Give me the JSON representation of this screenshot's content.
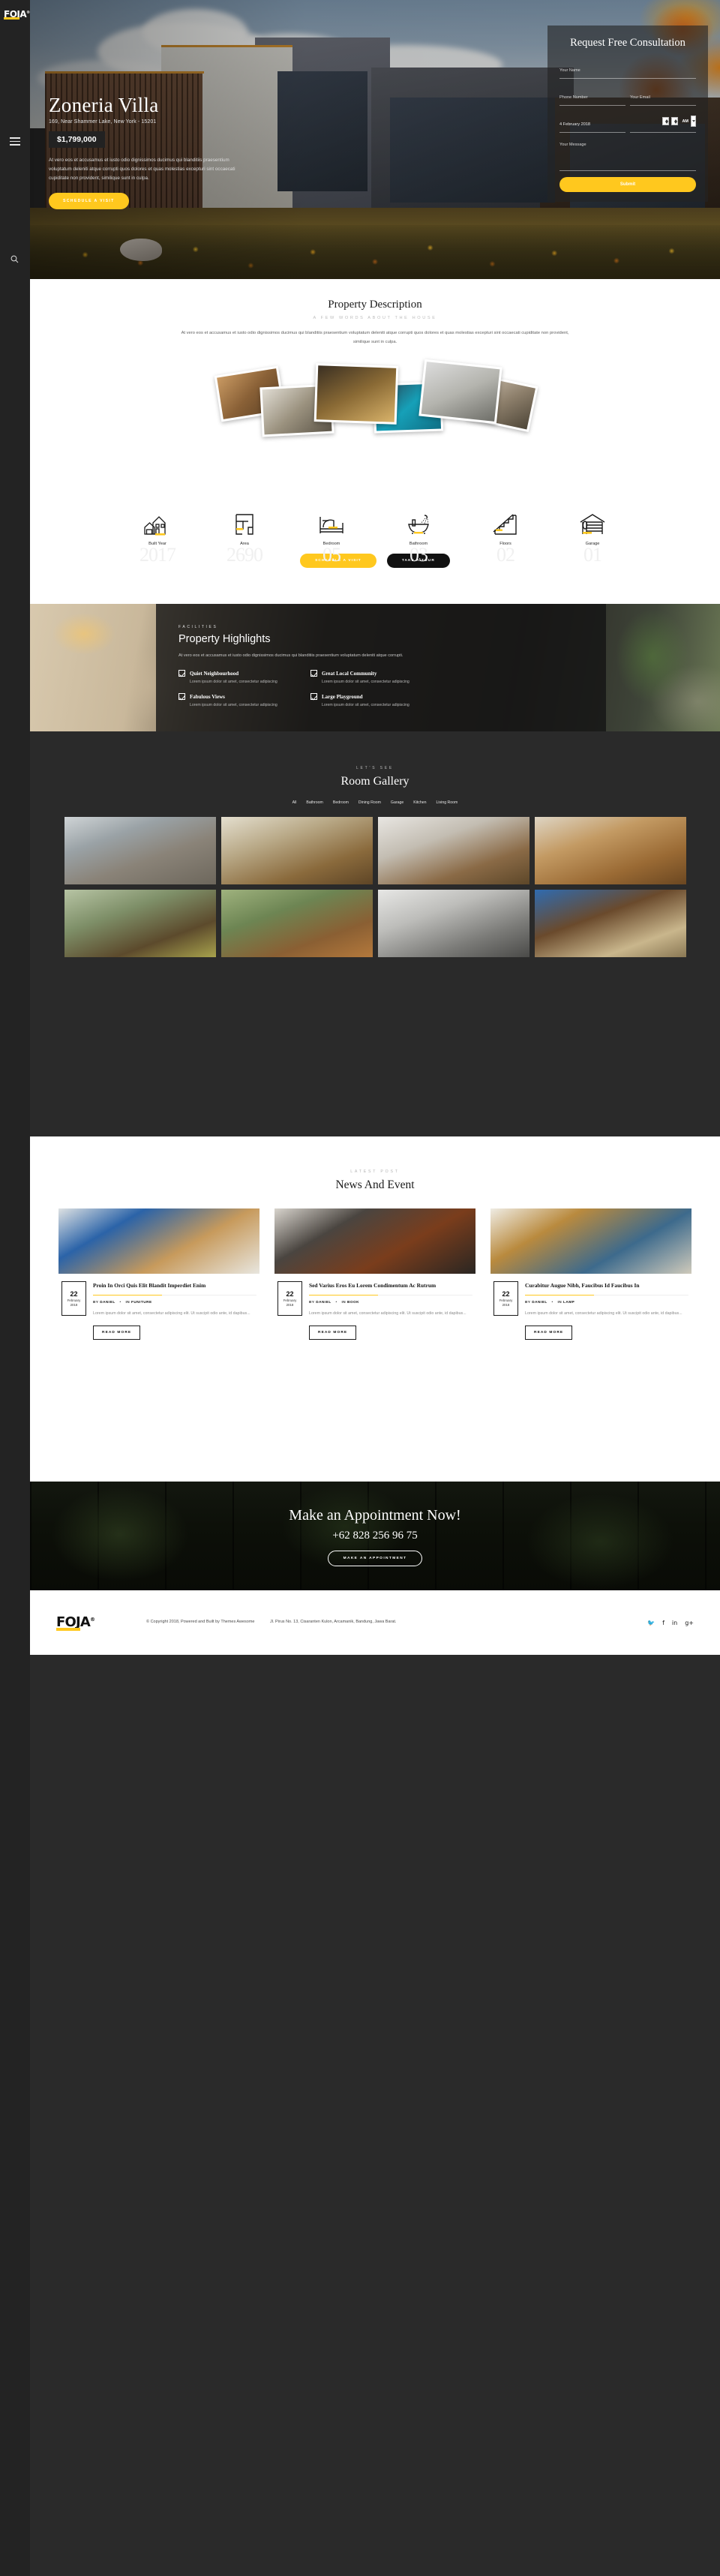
{
  "brand": {
    "name": "FOJA",
    "registered": "®",
    "accent": "#ffc81e"
  },
  "sidebar": {
    "menu_icon": "hamburger-icon",
    "search_icon": "search-icon"
  },
  "hero": {
    "title": "Zoneria Villa",
    "address": "169, Near Shammer Lake, New York - 15201",
    "price": "$1,799,000",
    "description": "At vero eos et accusamus et iusto odio dignissimos ducimus qui blanditiis praesentium voluptatum deleniti atque corrupti quos dolores et quas molestias excepturi sint occaecati cupiditate non provident, similique sunt in culpa.",
    "cta_label": "SCHEDULE A VISIT"
  },
  "consultation": {
    "heading": "Request Free Consultation",
    "name_placeholder": "Your Name",
    "phone_placeholder": "Phone Number",
    "email_placeholder": "Your Email",
    "date_value": "4 February 2018",
    "time_meridiem": "AM",
    "message_placeholder": "Your Message",
    "submit_label": "Submit"
  },
  "description_section": {
    "title": "Property Description",
    "subtitle": "A FEW WORDS ABOUT THE HOUSE",
    "body": "At vero eos et accusamus et iusto odio dignissimos ducimus qui blanditiis praesentium voluptatum deleniti atque corrupti quos dolores et quas molestias excepturi sint occaecati cupiditate non provident, similique sunt in culpa."
  },
  "features": {
    "items": [
      {
        "label": "Built Year",
        "value": "2017",
        "icon": "house-icon"
      },
      {
        "label": "Area",
        "value": "2690",
        "icon": "floorplan-icon"
      },
      {
        "label": "Bedroom",
        "value": "05",
        "icon": "bed-icon"
      },
      {
        "label": "Bathroom",
        "value": "03",
        "icon": "bathtub-shower-icon"
      },
      {
        "label": "Floors",
        "value": "02",
        "icon": "stairs-icon"
      },
      {
        "label": "Garage",
        "value": "01",
        "icon": "garage-icon"
      }
    ],
    "primary_button": "SCHEDULE A VISIT",
    "secondary_button": "TAKE A TOUR"
  },
  "highlights": {
    "kicker": "FACILITIES",
    "heading": "Property Highlights",
    "body": "At vero eos et accusamus et iusto odio dignissimos ducimus qui blanditiis praesentium voluptatum deleniti atque corrupti.",
    "items": [
      {
        "title": "Quiet Neighbourhood",
        "desc": "Lorem ipsum dolor sit amet, consectetur adipiscing"
      },
      {
        "title": "Great Local Community",
        "desc": "Lorem ipsum dolor sit amet, consectetur adipiscing"
      },
      {
        "title": "Fabulous Views",
        "desc": "Lorem ipsum dolor sit amet, consectetur adipiscing"
      },
      {
        "title": "Large Playground",
        "desc": "Lorem ipsum dolor sit amet, consectetur adipiscing"
      }
    ]
  },
  "gallery": {
    "kicker": "LET'S SEE",
    "heading": "Room Gallery",
    "filters": [
      "All",
      "Bathroom",
      "Bedroom",
      "Dining Room",
      "Garage",
      "Kitchen",
      "Living Room"
    ],
    "tiles": [
      {
        "name": "living-room-fireplace",
        "color": "linear-gradient(160deg,#cfd4d6 0%,#9aa2a6 30%,#8a8378 60%,#6d675c 100%)"
      },
      {
        "name": "dining-room-table",
        "color": "linear-gradient(160deg,#e4dfcf 0%,#b8a886 35%,#8a6a3c 70%,#5e4526 100%)"
      },
      {
        "name": "kitchen-counter",
        "color": "linear-gradient(160deg,#e8e6e2 0%,#c3bdb2 35%,#8a6a46 70%,#5d4729 100%)"
      },
      {
        "name": "living-room-sofa",
        "color": "linear-gradient(160deg,#ded5c4 0%,#c39a63 35%,#9a6a34 70%,#6b4721 100%)"
      },
      {
        "name": "bathroom-forest-view",
        "color": "linear-gradient(160deg,#b7c4a4 0%,#7e8f68 35%,#5c4a2c 70%,#a7a24c 100%)"
      },
      {
        "name": "bedroom-glass-wall",
        "color": "linear-gradient(160deg,#9fb27e 0%,#6d8553 35%,#8a5f33 70%,#b4793c 100%)"
      },
      {
        "name": "bathroom-tub",
        "color": "linear-gradient(160deg,#e7e7e5 0%,#bdbdba 35%,#7b7b78 70%,#4a4a48 100%)"
      },
      {
        "name": "garage-exterior",
        "color": "linear-gradient(160deg,#2f6bb0 0%,#6a4a2c 40%,#c9b68c 75%,#8a7854 100%)"
      }
    ]
  },
  "news": {
    "kicker": "LATEST POST",
    "heading": "News And Event",
    "read_more_label": "READ MORE",
    "posts": [
      {
        "title": "Proin In Orci Quis Elit Blandit Imperdiet Enim",
        "day": "22",
        "month": "February",
        "year": "2018",
        "author_prefix": "BY",
        "author": "DANIEL",
        "sep": "•",
        "category_prefix": "IN",
        "category": "FUNITURE",
        "excerpt": "Lorem ipsum dolor sit amet, consectetur adipiscing elit. Ut suscipit odio ante, id dapibus...",
        "image": "linear-gradient(150deg,#dfe2e3 0%,#2b63a8 28%,#c79a5c 62%,#e8e6df 100%)"
      },
      {
        "title": "Sed Varius Eros Eu Lorem Condimentum Ac Rutrum",
        "day": "22",
        "month": "February",
        "year": "2018",
        "author_prefix": "BY",
        "author": "DANIEL",
        "sep": "•",
        "category_prefix": "IN",
        "category": "BOOK",
        "excerpt": "Lorem ipsum dolor sit amet, consectetur adipiscing elit. Ut suscipit odio ante, id dapibus...",
        "image": "linear-gradient(150deg,#d8d4cd 0%,#4a4540 30%,#7a3d1c 62%,#2a2622 100%)"
      },
      {
        "title": "Curabitur Augue Nibh, Faucibus Id Faucibus In",
        "day": "22",
        "month": "February",
        "year": "2018",
        "author_prefix": "BY",
        "author": "DANIEL",
        "sep": "•",
        "category_prefix": "IN",
        "category": "LAMP",
        "excerpt": "Lorem ipsum dolor sit amet, consectetur adipiscing elit. Ut suscipit odio ante, id dapibus...",
        "image": "linear-gradient(150deg,#efece4 0%,#b98a3e 30%,#3d6a8c 65%,#cfcabb 100%)"
      }
    ]
  },
  "appointment": {
    "heading": "Make an Appointment Now!",
    "phone": "+62 828 256 96 75",
    "button_label": "MAKE AN APPOINTMENT"
  },
  "footer": {
    "copyright": "© Copyright 2018, Powered and Built by Themes Awesome",
    "address": "Jl. Pirus No. 13, Cisaranten Kulon, Arcamanik, Bandung, Jawa Barat.",
    "social": [
      {
        "name": "twitter-icon",
        "glyph": "🐦"
      },
      {
        "name": "facebook-icon",
        "glyph": "f"
      },
      {
        "name": "linkedin-icon",
        "glyph": "in"
      },
      {
        "name": "googleplus-icon",
        "glyph": "g+"
      }
    ]
  }
}
